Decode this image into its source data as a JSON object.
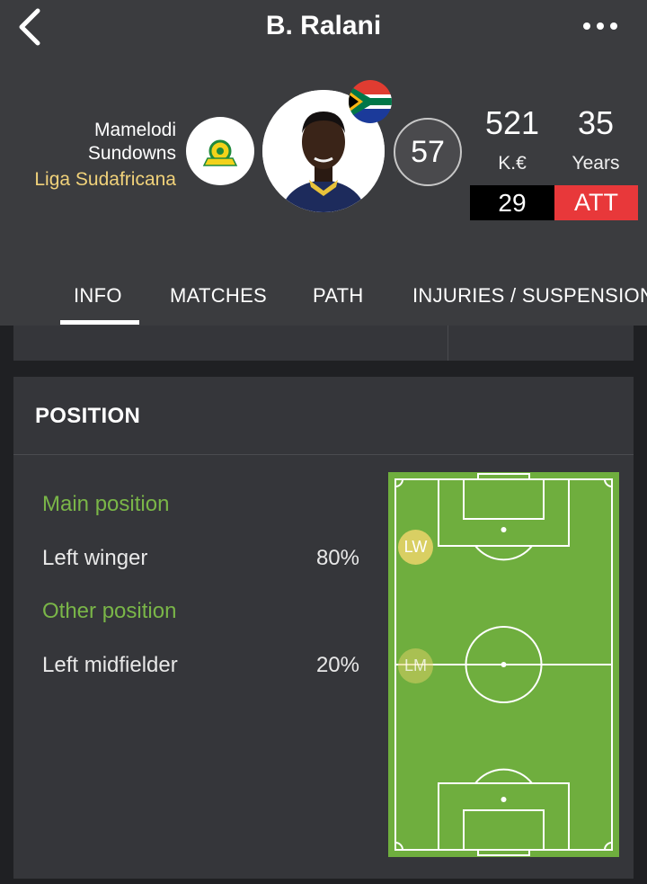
{
  "header": {
    "title": "B. Ralani",
    "team_line1": "Mamelodi",
    "team_line2": "Sundowns",
    "league": "Liga Sudafricana",
    "rating": "57",
    "value": "521",
    "value_unit": "K.€",
    "age": "35",
    "age_unit": "Years",
    "shirt_number": "29",
    "position_code": "ATT"
  },
  "tabs": [
    {
      "label": "INFO",
      "active": true
    },
    {
      "label": "MATCHES"
    },
    {
      "label": "PATH"
    },
    {
      "label": "INJURIES / SUSPENSION"
    }
  ],
  "position_card": {
    "title": "POSITION",
    "main_label": "Main position",
    "main": {
      "name": "Left winger",
      "pct": "80%"
    },
    "other_label": "Other position",
    "other": {
      "name": "Left midfielder",
      "pct": "20%"
    },
    "markers": [
      "LW",
      "LM"
    ]
  },
  "icons": {
    "back": "back-chevron-icon",
    "more": "more-dots-icon",
    "team": "team-crest-icon",
    "flag": "south-africa-flag-icon"
  },
  "colors": {
    "header_bg": "#3b3c3f",
    "card_bg": "#35363a",
    "accent_green": "#7ab648",
    "league_gold": "#f1d27a",
    "att_red": "#e8383a",
    "pitch_green": "#6fae3e",
    "marker_yellow": "#d9cf63"
  }
}
